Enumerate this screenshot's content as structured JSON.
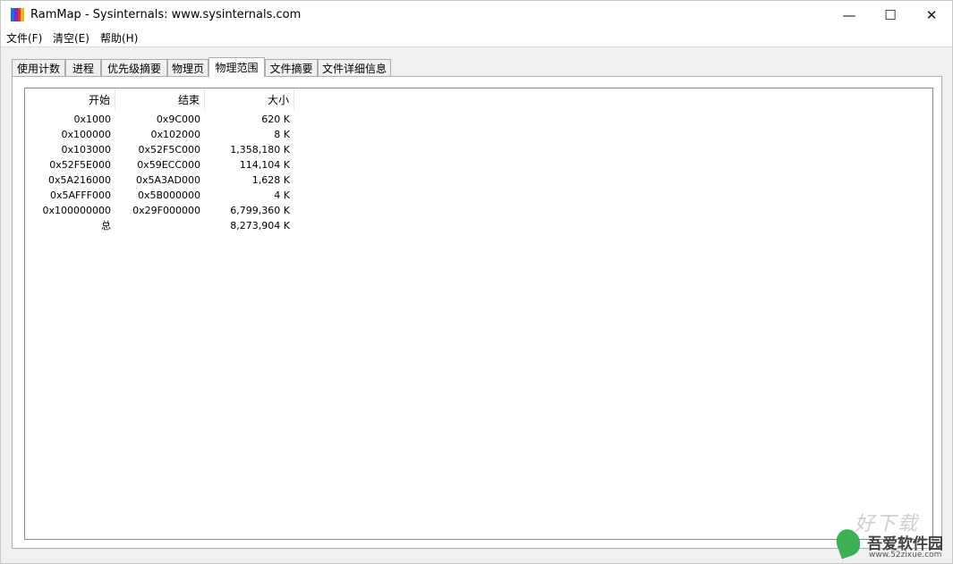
{
  "window": {
    "title": "RamMap - Sysinternals: www.sysinternals.com",
    "icon": "rammap-app-icon",
    "controls": {
      "minimize": "—",
      "maximize": "☐",
      "close": "✕"
    }
  },
  "menu": [
    {
      "label": "文件(F)"
    },
    {
      "label": "清空(E)"
    },
    {
      "label": "帮助(H)"
    }
  ],
  "tabs": [
    {
      "label": "使用计数"
    },
    {
      "label": "进程"
    },
    {
      "label": "优先级摘要"
    },
    {
      "label": "物理页"
    },
    {
      "label": "物理范围",
      "active": true
    },
    {
      "label": "文件摘要"
    },
    {
      "label": "文件详细信息"
    }
  ],
  "table": {
    "headers": [
      "开始",
      "结束",
      "大小"
    ],
    "rows": [
      [
        "0x1000",
        "0x9C000",
        "620 K"
      ],
      [
        "0x100000",
        "0x102000",
        "8 K"
      ],
      [
        "0x103000",
        "0x52F5C000",
        "1,358,180 K"
      ],
      [
        "0x52F5E000",
        "0x59ECC000",
        "114,104 K"
      ],
      [
        "0x5A216000",
        "0x5A3AD000",
        "1,628 K"
      ],
      [
        "0x5AFFF000",
        "0x5B000000",
        "4 K"
      ],
      [
        "0x100000000",
        "0x29F000000",
        "6,799,360 K"
      ],
      [
        "总",
        "",
        "8,273,904 K"
      ]
    ]
  },
  "watermark": {
    "brand": "吾爱软件园",
    "url": "www.52zixue.com",
    "faded_text": "好下载"
  },
  "colors": {
    "titlebar": "#ffffff",
    "face": "#f0f0f0",
    "border": "#adadad"
  }
}
